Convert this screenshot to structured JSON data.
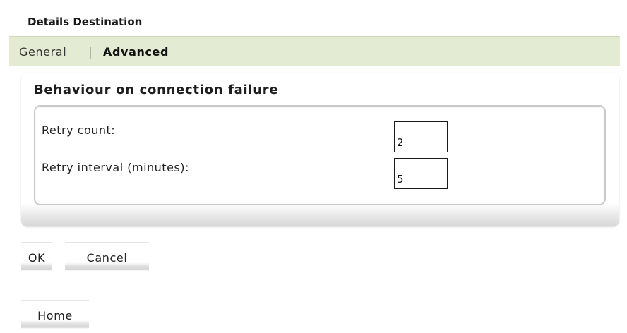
{
  "header": {
    "title": "Details Destination"
  },
  "tabs": {
    "general": "General",
    "separator": "|",
    "advanced": "Advanced"
  },
  "section": {
    "title": "Behaviour on connection failure",
    "retry_count": {
      "label": "Retry count:",
      "value": "2"
    },
    "retry_interval": {
      "label": "Retry interval (minutes):",
      "value": "5"
    }
  },
  "actions": {
    "ok": "OK",
    "cancel": "Cancel"
  },
  "nav": {
    "home": "Home"
  }
}
